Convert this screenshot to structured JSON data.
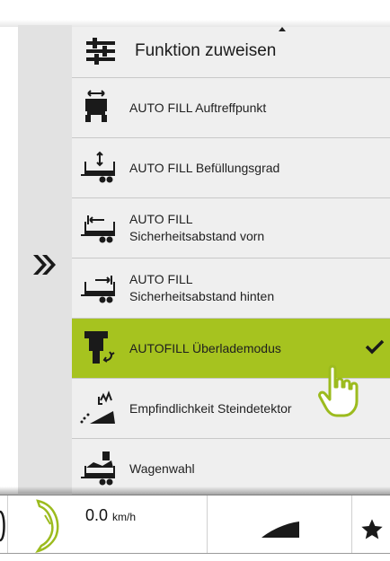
{
  "menu": {
    "title": "Funktion zuweisen",
    "items": [
      {
        "label1": "AUTO FILL Auftreffpunkt",
        "label2": "",
        "icon": "auftreffpunkt-icon",
        "selected": false
      },
      {
        "label1": "AUTO FILL Befüllungsgrad",
        "label2": "",
        "icon": "befuellungsgrad-icon",
        "selected": false
      },
      {
        "label1": "AUTO FILL",
        "label2": "Sicherheitsabstand vorn",
        "icon": "sicherheitsabstand-vorn-icon",
        "selected": false
      },
      {
        "label1": "AUTO FILL",
        "label2": "Sicherheitsabstand hinten",
        "icon": "sicherheitsabstand-hinten-icon",
        "selected": false
      },
      {
        "label1": "AUTOFILL Überlademodus",
        "label2": "",
        "icon": "ueberlademodus-icon",
        "selected": true
      },
      {
        "label1": "Empfindlichkeit Steindetektor",
        "label2": "",
        "icon": "steindetektor-icon",
        "selected": false
      },
      {
        "label1": "Wagenwahl",
        "label2": "",
        "icon": "wagenwahl-icon",
        "selected": false
      }
    ]
  },
  "status": {
    "speed_value": "0.0",
    "speed_unit": "km/h"
  },
  "colors": {
    "selected_bg": "#a6c31f",
    "menu_bg": "#efefef",
    "rail_bg": "#e2e2e2"
  }
}
